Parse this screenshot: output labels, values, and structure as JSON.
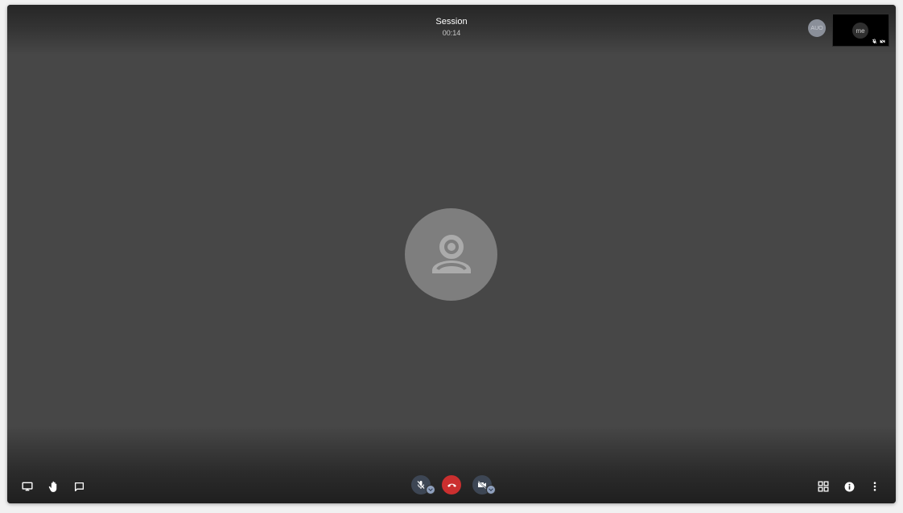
{
  "session": {
    "title": "Session",
    "timer": "00:14"
  },
  "participants": {
    "remote_initials": "AUO",
    "self_label": "me"
  },
  "toolbar": {
    "left": [
      {
        "name": "screen-share",
        "icon": "monitor-icon"
      },
      {
        "name": "raise-hand",
        "icon": "hand-icon"
      },
      {
        "name": "chat",
        "icon": "chat-bubble-icon"
      }
    ],
    "center": [
      {
        "name": "microphone",
        "icon": "mic-off-icon",
        "state": "muted"
      },
      {
        "name": "hangup",
        "icon": "phone-hangup-icon",
        "color": "#cb2f2f"
      },
      {
        "name": "camera",
        "icon": "video-off-icon",
        "state": "off"
      }
    ],
    "right": [
      {
        "name": "tile-view",
        "icon": "grid-icon"
      },
      {
        "name": "info",
        "icon": "info-icon"
      },
      {
        "name": "more",
        "icon": "more-vertical-icon"
      }
    ]
  },
  "colors": {
    "stage_background": "#474747",
    "hangup_red": "#cb2f2f",
    "control_navy": "#3d4654",
    "avatar_gray": "#7e7e7e"
  }
}
